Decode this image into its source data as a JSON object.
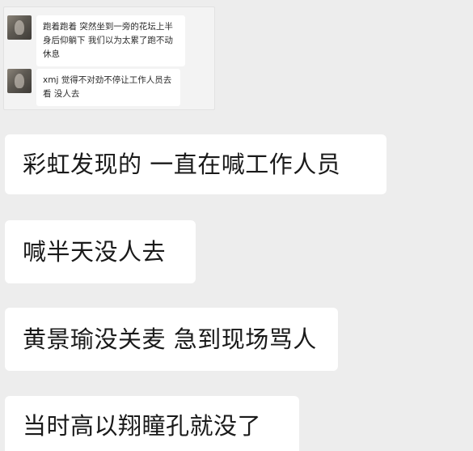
{
  "quoted_chat": {
    "messages": [
      {
        "avatar": "user-avatar",
        "text": "跑着跑着 突然坐到一旁的花坛上半\n身后仰躺下 我们以为太累了跑不动\n休息"
      },
      {
        "avatar": "user-avatar",
        "text": "xmj 觉得不对劲不停让工作人员去\n看 没人去"
      }
    ]
  },
  "messages": [
    {
      "text": "彩虹发现的 一直在喊工作人员"
    },
    {
      "text": "喊半天没人去"
    },
    {
      "text": "黄景瑜没关麦 急到现场骂人"
    },
    {
      "text": "当时高以翔瞳孔就没了"
    }
  ],
  "colors": {
    "background": "#ededed",
    "bubble": "#ffffff",
    "text": "#1a1a1a"
  }
}
